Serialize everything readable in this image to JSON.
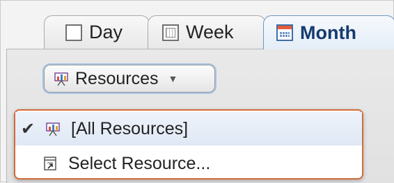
{
  "tabs": [
    {
      "label": "Day",
      "icon": "day-calendar-icon",
      "selected": false
    },
    {
      "label": "Week",
      "icon": "week-calendar-icon",
      "selected": false
    },
    {
      "label": "Month",
      "icon": "month-calendar-icon",
      "selected": true
    }
  ],
  "resources_button": {
    "label": "Resources",
    "icon": "resources-icon",
    "caret_icon": "dropdown-caret-icon"
  },
  "menu": {
    "items": [
      {
        "label": "[All Resources]",
        "checked": true,
        "icon": "resources-icon"
      },
      {
        "label": "Select Resource...",
        "checked": false,
        "icon": "select-resource-icon"
      }
    ]
  },
  "colors": {
    "accent": "#d26b3a",
    "selected_tab_border": "#6b97c6",
    "focus_ring": "#a9c4e6"
  }
}
